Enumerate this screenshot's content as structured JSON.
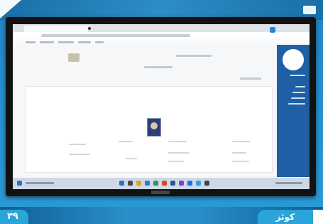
{
  "page_number": "۳۹",
  "chapter_label": "کوئز",
  "colors": {
    "band": "#2a8fc9",
    "sidebar": "#1e5fa6",
    "tag": "#2aa5d9",
    "screen_bg": "#f6f7f9"
  },
  "icons": [
    "monitor-icon",
    "avatar-icon",
    "photo-icon",
    "taskbar-icons"
  ]
}
